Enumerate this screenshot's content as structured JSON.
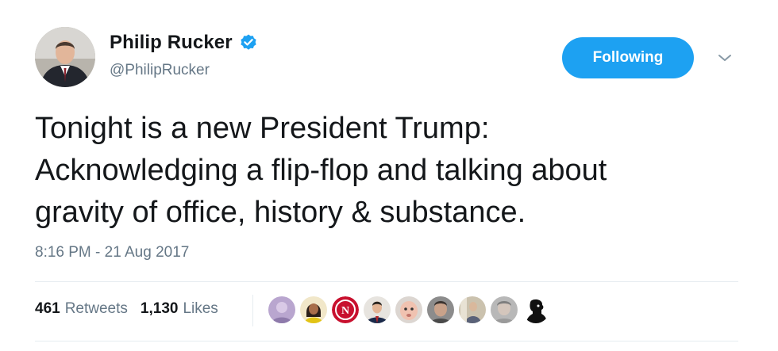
{
  "user": {
    "display_name": "Philip Rucker",
    "handle": "@PhilipRucker",
    "verified": true
  },
  "follow_button": {
    "label": "Following"
  },
  "tweet": {
    "lines": [
      "Tonight is a new President Trump:",
      "Acknowledging a flip-flop and talking about",
      "gravity of office, history & substance."
    ],
    "timestamp": "8:16 PM - 21 Aug 2017"
  },
  "stats": {
    "retweets_count": "461",
    "retweets_label": "Retweets",
    "likes_count": "1,130",
    "likes_label": "Likes"
  },
  "likers": [
    {
      "icon": "liker-avatar-1-icon"
    },
    {
      "icon": "liker-avatar-2-icon"
    },
    {
      "icon": "liker-avatar-3-icon"
    },
    {
      "icon": "liker-avatar-4-icon"
    },
    {
      "icon": "liker-avatar-5-icon"
    },
    {
      "icon": "liker-avatar-6-icon"
    },
    {
      "icon": "liker-avatar-7-icon"
    },
    {
      "icon": "liker-avatar-8-icon"
    },
    {
      "icon": "liker-avatar-9-icon"
    }
  ],
  "colors": {
    "accent": "#1da1f2",
    "text_primary": "#14171a",
    "text_secondary": "#657786",
    "divider": "#e6ecf0"
  }
}
